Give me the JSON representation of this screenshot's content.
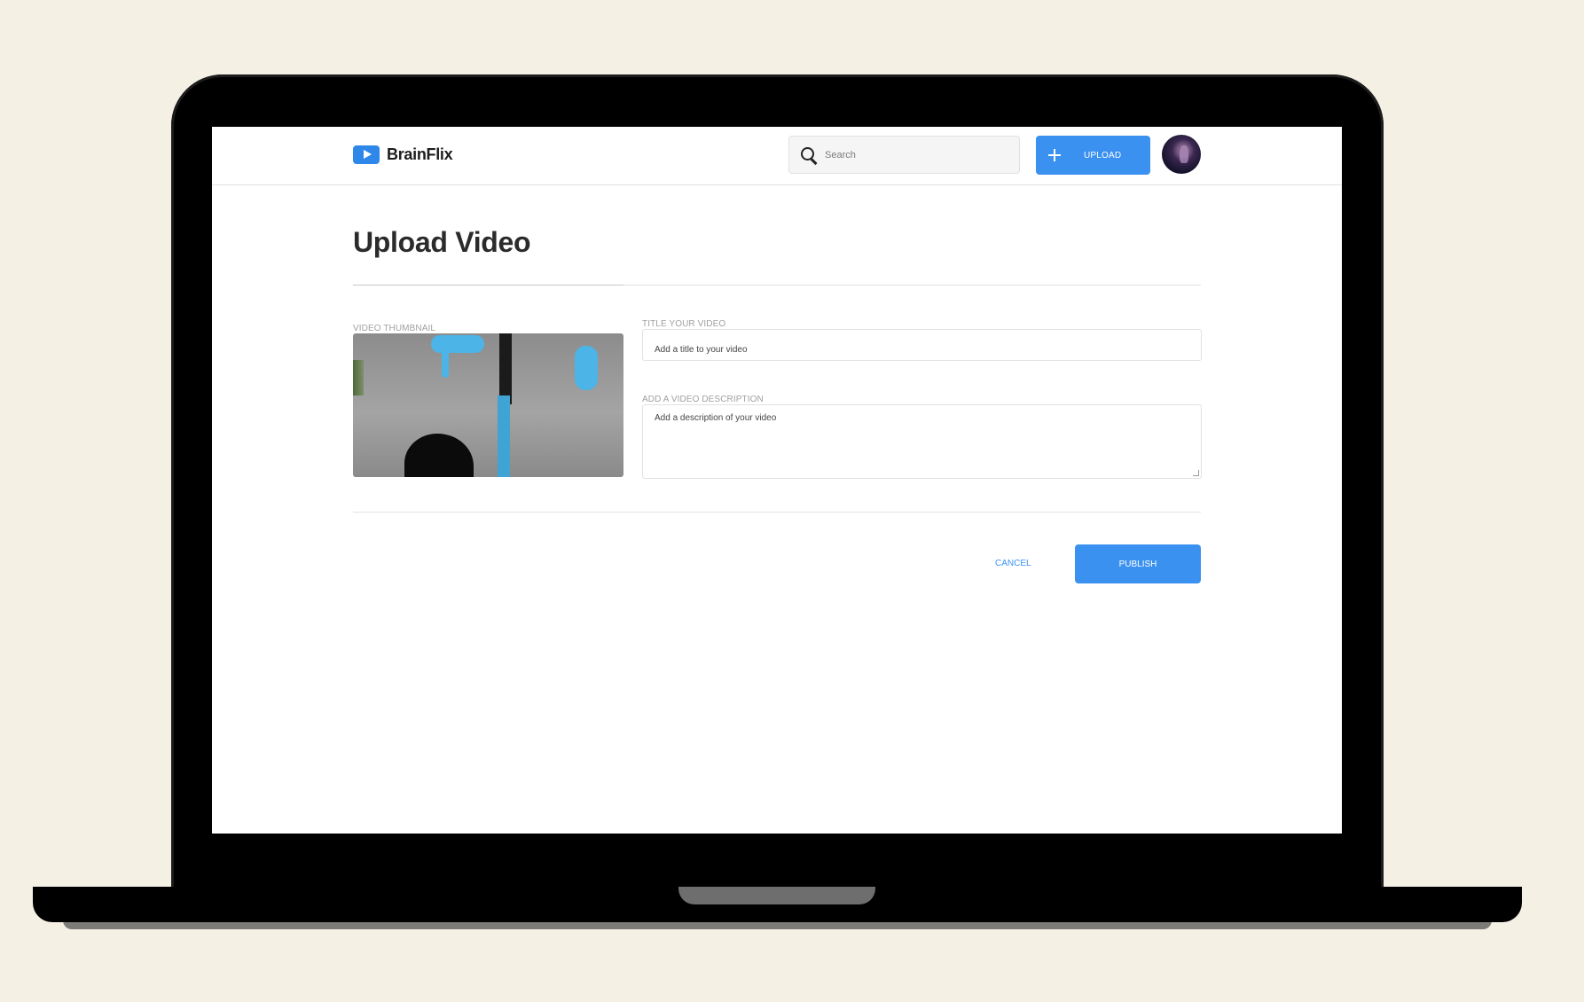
{
  "app": {
    "brand": "BrainFlix"
  },
  "header": {
    "search_placeholder": "Search",
    "upload_label": "UPLOAD"
  },
  "page": {
    "title": "Upload Video"
  },
  "form": {
    "thumbnail_label": "VIDEO THUMBNAIL",
    "title_label": "TITLE YOUR VIDEO",
    "title_placeholder": "Add a title to your video",
    "title_value": "",
    "description_label": "ADD A VIDEO DESCRIPTION",
    "description_placeholder": "Add a description of your video",
    "description_value": ""
  },
  "actions": {
    "cancel_label": "CANCEL",
    "publish_label": "PUBLISH"
  },
  "colors": {
    "accent": "#3b91f0",
    "background": "#f5f0e4"
  },
  "icons": {
    "logo": "play-icon",
    "search": "search-icon",
    "upload": "plus-icon"
  }
}
